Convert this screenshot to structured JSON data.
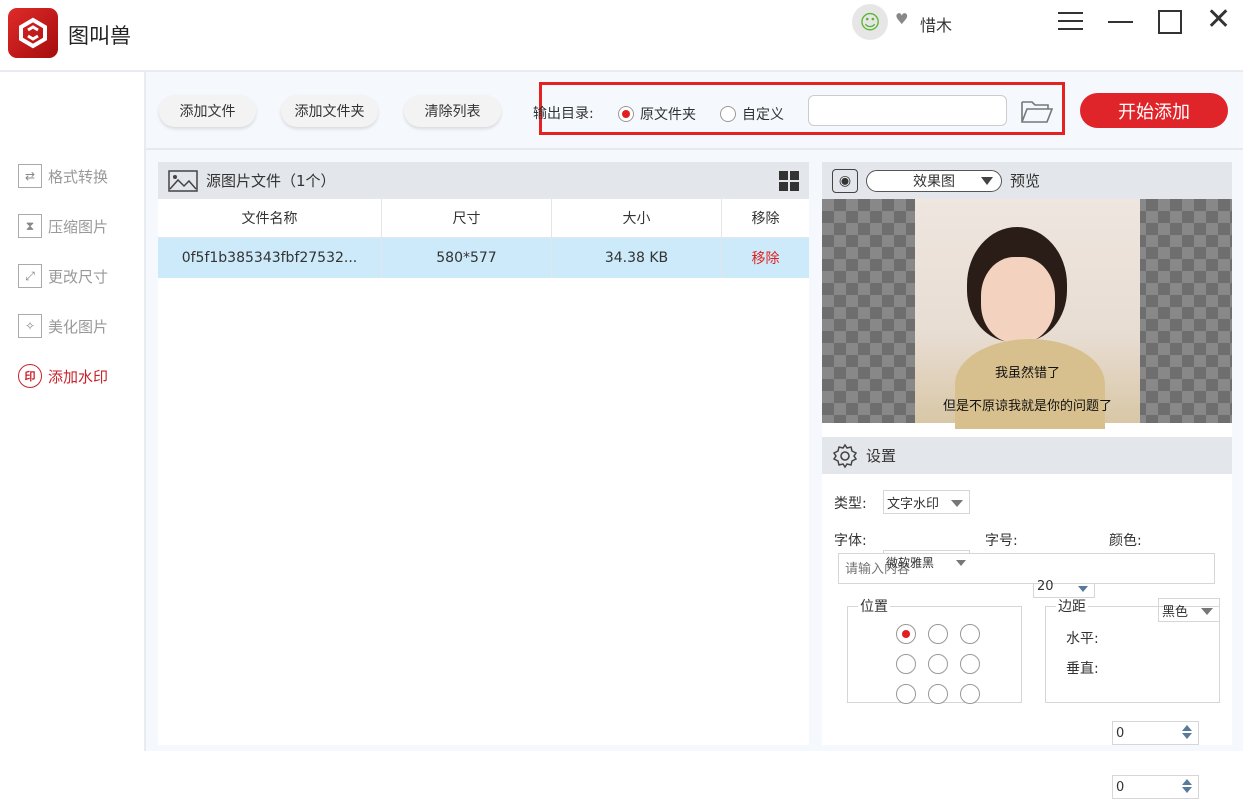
{
  "app": {
    "title": "图叫兽",
    "username": "惜木"
  },
  "sidebar": {
    "items": [
      {
        "label": "格式转换",
        "icon": "⇄"
      },
      {
        "label": "压缩图片",
        "icon": "⧗"
      },
      {
        "label": "更改尺寸",
        "icon": "⤢"
      },
      {
        "label": "美化图片",
        "icon": "✧"
      },
      {
        "label": "添加水印",
        "icon": "印",
        "active": true
      }
    ]
  },
  "toolbar": {
    "add_file": "添加文件",
    "add_folder": "添加文件夹",
    "clear_list": "清除列表",
    "output_label": "输出目录:",
    "opt_original": "原文件夹",
    "opt_custom": "自定义",
    "output_path": "",
    "start": "开始添加"
  },
  "filelist": {
    "title": "源图片文件（1个）",
    "columns": [
      "文件名称",
      "尺寸",
      "大小",
      "移除"
    ],
    "rows": [
      {
        "name": "0f5f1b385343fbf27532...",
        "size": "580*577",
        "filesize": "34.38 KB",
        "remove": "移除"
      }
    ]
  },
  "preview": {
    "mode": "效果图",
    "label": "预览",
    "caption_line1": "我虽然错了",
    "caption_line2": "但是不原谅我就是你的问题了"
  },
  "settings": {
    "title": "设置",
    "type_label": "类型:",
    "type_value": "文字水印",
    "font_label": "字体:",
    "font_value": "微软雅黑",
    "size_label": "字号:",
    "size_value": "20",
    "color_label": "颜色:",
    "color_value": "黑色",
    "content_placeholder": "请输入内容",
    "position_label": "位置",
    "margin_label": "边距",
    "horizontal_label": "水平:",
    "horizontal_value": "0",
    "vertical_label": "垂直:",
    "vertical_value": "0",
    "selected_position": 0
  },
  "colors": {
    "accent": "#e0252a",
    "selected_row": "#cdeafa",
    "panel_header": "#e3e6ea"
  }
}
